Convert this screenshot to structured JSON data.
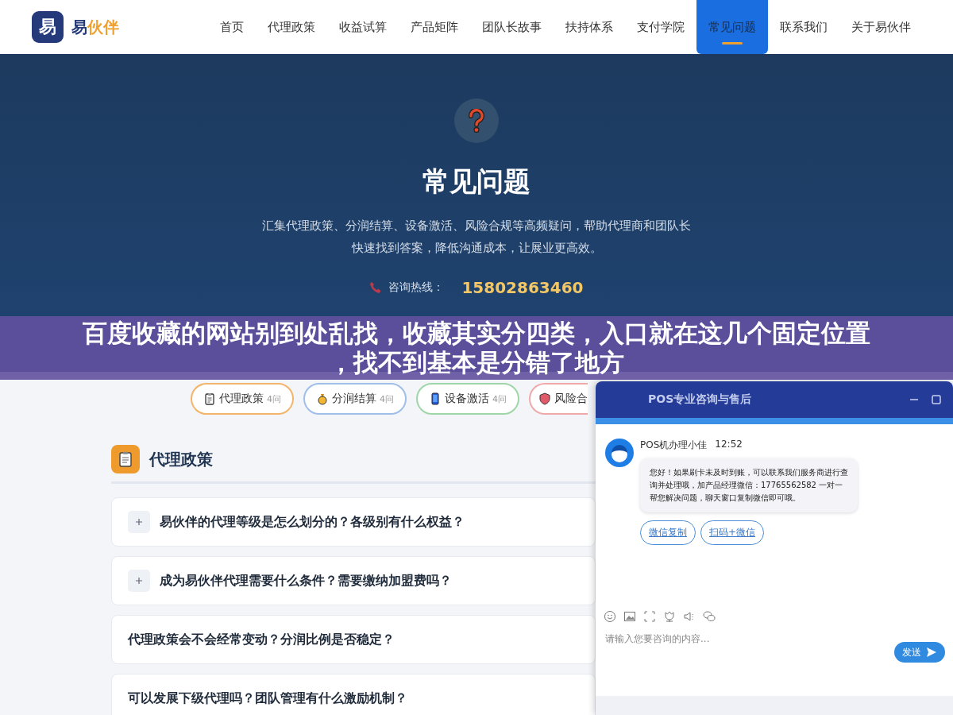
{
  "header": {
    "logo_mark": "易",
    "logo_text": "易",
    "logo_accent": "伙伴"
  },
  "nav": [
    {
      "label": "首页",
      "selected": false
    },
    {
      "label": "代理政策",
      "selected": false
    },
    {
      "label": "收益试算",
      "selected": false
    },
    {
      "label": "产品矩阵",
      "selected": false
    },
    {
      "label": "团队长故事",
      "selected": false
    },
    {
      "label": "扶持体系",
      "selected": false
    },
    {
      "label": "支付学院",
      "selected": false
    },
    {
      "label": "常见问题",
      "selected": true
    },
    {
      "label": "联系我们",
      "selected": false
    },
    {
      "label": "关于易伙伴",
      "selected": false
    }
  ],
  "hero": {
    "title": "常见问题",
    "description": "汇集代理政策、分润结算、设备激活、风险合规等高频疑问，帮助代理商和团队长快速找到答案，降低沟通成本，让展业更高效。",
    "hotline_label": "咨询热线：",
    "hotline_number": "15802863460"
  },
  "categories": [
    {
      "kind": "clipboard",
      "label": "代理政策",
      "count": "4问",
      "color": "#f2b56b"
    },
    {
      "kind": "coin",
      "label": "分润结算",
      "count": "4问",
      "color": "#9fbfe8"
    },
    {
      "kind": "phone",
      "label": "设备激活",
      "count": "4问",
      "color": "#9fd6a8"
    },
    {
      "kind": "shield",
      "label": "风险合",
      "color": "#f0a9a9"
    }
  ],
  "section": {
    "title": "代理政策"
  },
  "faqs": [
    {
      "question": "易伙伴的代理等级是怎么划分的？各级别有什么权益？",
      "expandable": true
    },
    {
      "question": "成为易伙伴代理需要什么条件？需要缴纳加盟费吗？",
      "expandable": true
    },
    {
      "question": "代理政策会不会经常变动？分润比例是否稳定？",
      "expandable": false
    },
    {
      "question": "可以发展下级代理吗？团队管理有什么激励机制？",
      "expandable": false
    }
  ],
  "chat": {
    "title": "POS专业咨询与售后",
    "sender": "POS机办理小佳",
    "time": "12:52",
    "message": "您好！如果刷卡未及时到账，可以联系我们服务商进行查询并处理哦，加产品经理微信：17765562582 一对一帮您解决问题，聊天窗口复制微信即可哦。",
    "quick_replies": [
      "微信复制",
      "扫码+微信"
    ],
    "input_placeholder": "请输入您要咨询的内容...",
    "send_label": "发送"
  },
  "banner": {
    "lines": [
      "百度收藏的网站别到处乱找，收藏其实分四类，入口就在这几个固定位置",
      "，找不到基本是分错了地方"
    ]
  }
}
